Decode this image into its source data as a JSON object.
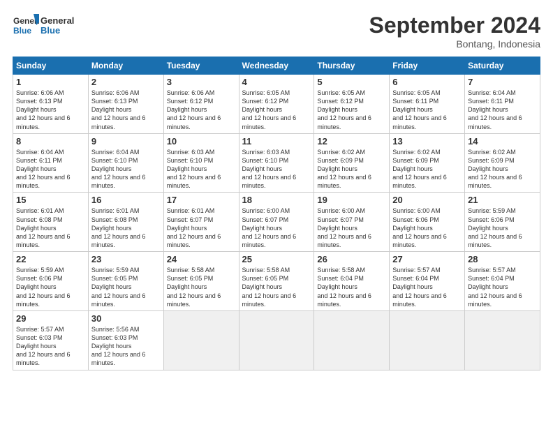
{
  "header": {
    "logo_line1": "General",
    "logo_line2": "Blue",
    "month_title": "September 2024",
    "location": "Bontang, Indonesia"
  },
  "days_of_week": [
    "Sunday",
    "Monday",
    "Tuesday",
    "Wednesday",
    "Thursday",
    "Friday",
    "Saturday"
  ],
  "weeks": [
    [
      {
        "day": "1",
        "sunrise": "6:06 AM",
        "sunset": "6:13 PM",
        "daylight": "12 hours and 6 minutes."
      },
      {
        "day": "2",
        "sunrise": "6:06 AM",
        "sunset": "6:13 PM",
        "daylight": "12 hours and 6 minutes."
      },
      {
        "day": "3",
        "sunrise": "6:06 AM",
        "sunset": "6:12 PM",
        "daylight": "12 hours and 6 minutes."
      },
      {
        "day": "4",
        "sunrise": "6:05 AM",
        "sunset": "6:12 PM",
        "daylight": "12 hours and 6 minutes."
      },
      {
        "day": "5",
        "sunrise": "6:05 AM",
        "sunset": "6:12 PM",
        "daylight": "12 hours and 6 minutes."
      },
      {
        "day": "6",
        "sunrise": "6:05 AM",
        "sunset": "6:11 PM",
        "daylight": "12 hours and 6 minutes."
      },
      {
        "day": "7",
        "sunrise": "6:04 AM",
        "sunset": "6:11 PM",
        "daylight": "12 hours and 6 minutes."
      }
    ],
    [
      {
        "day": "8",
        "sunrise": "6:04 AM",
        "sunset": "6:11 PM",
        "daylight": "12 hours and 6 minutes."
      },
      {
        "day": "9",
        "sunrise": "6:04 AM",
        "sunset": "6:10 PM",
        "daylight": "12 hours and 6 minutes."
      },
      {
        "day": "10",
        "sunrise": "6:03 AM",
        "sunset": "6:10 PM",
        "daylight": "12 hours and 6 minutes."
      },
      {
        "day": "11",
        "sunrise": "6:03 AM",
        "sunset": "6:10 PM",
        "daylight": "12 hours and 6 minutes."
      },
      {
        "day": "12",
        "sunrise": "6:02 AM",
        "sunset": "6:09 PM",
        "daylight": "12 hours and 6 minutes."
      },
      {
        "day": "13",
        "sunrise": "6:02 AM",
        "sunset": "6:09 PM",
        "daylight": "12 hours and 6 minutes."
      },
      {
        "day": "14",
        "sunrise": "6:02 AM",
        "sunset": "6:09 PM",
        "daylight": "12 hours and 6 minutes."
      }
    ],
    [
      {
        "day": "15",
        "sunrise": "6:01 AM",
        "sunset": "6:08 PM",
        "daylight": "12 hours and 6 minutes."
      },
      {
        "day": "16",
        "sunrise": "6:01 AM",
        "sunset": "6:08 PM",
        "daylight": "12 hours and 6 minutes."
      },
      {
        "day": "17",
        "sunrise": "6:01 AM",
        "sunset": "6:07 PM",
        "daylight": "12 hours and 6 minutes."
      },
      {
        "day": "18",
        "sunrise": "6:00 AM",
        "sunset": "6:07 PM",
        "daylight": "12 hours and 6 minutes."
      },
      {
        "day": "19",
        "sunrise": "6:00 AM",
        "sunset": "6:07 PM",
        "daylight": "12 hours and 6 minutes."
      },
      {
        "day": "20",
        "sunrise": "6:00 AM",
        "sunset": "6:06 PM",
        "daylight": "12 hours and 6 minutes."
      },
      {
        "day": "21",
        "sunrise": "5:59 AM",
        "sunset": "6:06 PM",
        "daylight": "12 hours and 6 minutes."
      }
    ],
    [
      {
        "day": "22",
        "sunrise": "5:59 AM",
        "sunset": "6:06 PM",
        "daylight": "12 hours and 6 minutes."
      },
      {
        "day": "23",
        "sunrise": "5:59 AM",
        "sunset": "6:05 PM",
        "daylight": "12 hours and 6 minutes."
      },
      {
        "day": "24",
        "sunrise": "5:58 AM",
        "sunset": "6:05 PM",
        "daylight": "12 hours and 6 minutes."
      },
      {
        "day": "25",
        "sunrise": "5:58 AM",
        "sunset": "6:05 PM",
        "daylight": "12 hours and 6 minutes."
      },
      {
        "day": "26",
        "sunrise": "5:58 AM",
        "sunset": "6:04 PM",
        "daylight": "12 hours and 6 minutes."
      },
      {
        "day": "27",
        "sunrise": "5:57 AM",
        "sunset": "6:04 PM",
        "daylight": "12 hours and 6 minutes."
      },
      {
        "day": "28",
        "sunrise": "5:57 AM",
        "sunset": "6:04 PM",
        "daylight": "12 hours and 6 minutes."
      }
    ],
    [
      {
        "day": "29",
        "sunrise": "5:57 AM",
        "sunset": "6:03 PM",
        "daylight": "12 hours and 6 minutes."
      },
      {
        "day": "30",
        "sunrise": "5:56 AM",
        "sunset": "6:03 PM",
        "daylight": "12 hours and 6 minutes."
      },
      {
        "day": "",
        "sunrise": "",
        "sunset": "",
        "daylight": ""
      },
      {
        "day": "",
        "sunrise": "",
        "sunset": "",
        "daylight": ""
      },
      {
        "day": "",
        "sunrise": "",
        "sunset": "",
        "daylight": ""
      },
      {
        "day": "",
        "sunrise": "",
        "sunset": "",
        "daylight": ""
      },
      {
        "day": "",
        "sunrise": "",
        "sunset": "",
        "daylight": ""
      }
    ]
  ]
}
